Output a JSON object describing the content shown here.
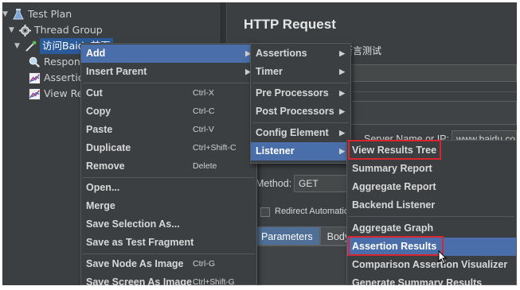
{
  "tree": {
    "items": [
      {
        "label": "Test Plan",
        "icon": "flask-icon"
      },
      {
        "label": "Thread Group",
        "icon": "gear-icon"
      },
      {
        "label": "访问Baidu首页",
        "icon": "pipette-icon"
      },
      {
        "label": "Respon",
        "icon": "magnifier-icon"
      },
      {
        "label": "Assertio",
        "icon": "graph-icon"
      },
      {
        "label": "View Re",
        "icon": "graph-icon"
      }
    ]
  },
  "panel": {
    "title": "HTTP Request",
    "name_value": "断言测试",
    "server_label": "Server Name or IP:",
    "server_value": "www.baidu.co",
    "method_label": "Method:",
    "method_value": "GET",
    "redirect_label": "Redirect Automatic",
    "tabs": [
      "Parameters",
      "Body D"
    ]
  },
  "context_menu": {
    "items": [
      {
        "label": "Add",
        "shortcut": "",
        "submenu": true
      },
      {
        "label": "Insert Parent",
        "shortcut": "",
        "submenu": true
      },
      {
        "label": "Cut",
        "shortcut": "Ctrl-X"
      },
      {
        "label": "Copy",
        "shortcut": "Ctrl-C"
      },
      {
        "label": "Paste",
        "shortcut": "Ctrl-V"
      },
      {
        "label": "Duplicate",
        "shortcut": "Ctrl+Shift-C"
      },
      {
        "label": "Remove",
        "shortcut": "Delete"
      },
      {
        "label": "Open...",
        "shortcut": ""
      },
      {
        "label": "Merge",
        "shortcut": ""
      },
      {
        "label": "Save Selection As...",
        "shortcut": ""
      },
      {
        "label": "Save as Test Fragment",
        "shortcut": ""
      },
      {
        "label": "Save Node As Image",
        "shortcut": "Ctrl-G"
      },
      {
        "label": "Save Screen As Image",
        "shortcut": "Ctrl+Shift-G"
      }
    ]
  },
  "add_menu": {
    "items": [
      {
        "label": "Assertions"
      },
      {
        "label": "Timer"
      },
      {
        "label": "Pre Processors"
      },
      {
        "label": "Post Processors"
      },
      {
        "label": "Config Element"
      },
      {
        "label": "Listener"
      }
    ]
  },
  "listener_menu": {
    "items": [
      {
        "label": "View Results Tree"
      },
      {
        "label": "Summary Report"
      },
      {
        "label": "Aggregate Report"
      },
      {
        "label": "Backend Listener"
      },
      {
        "label": "Aggregate Graph"
      },
      {
        "label": "Assertion Results"
      },
      {
        "label": "Comparison Assertion Visualizer"
      },
      {
        "label": "Generate Summary Results"
      }
    ]
  },
  "colors": {
    "background": "#3c3f41",
    "highlight": "#4a6ea9",
    "annotation": "#d9262e"
  }
}
